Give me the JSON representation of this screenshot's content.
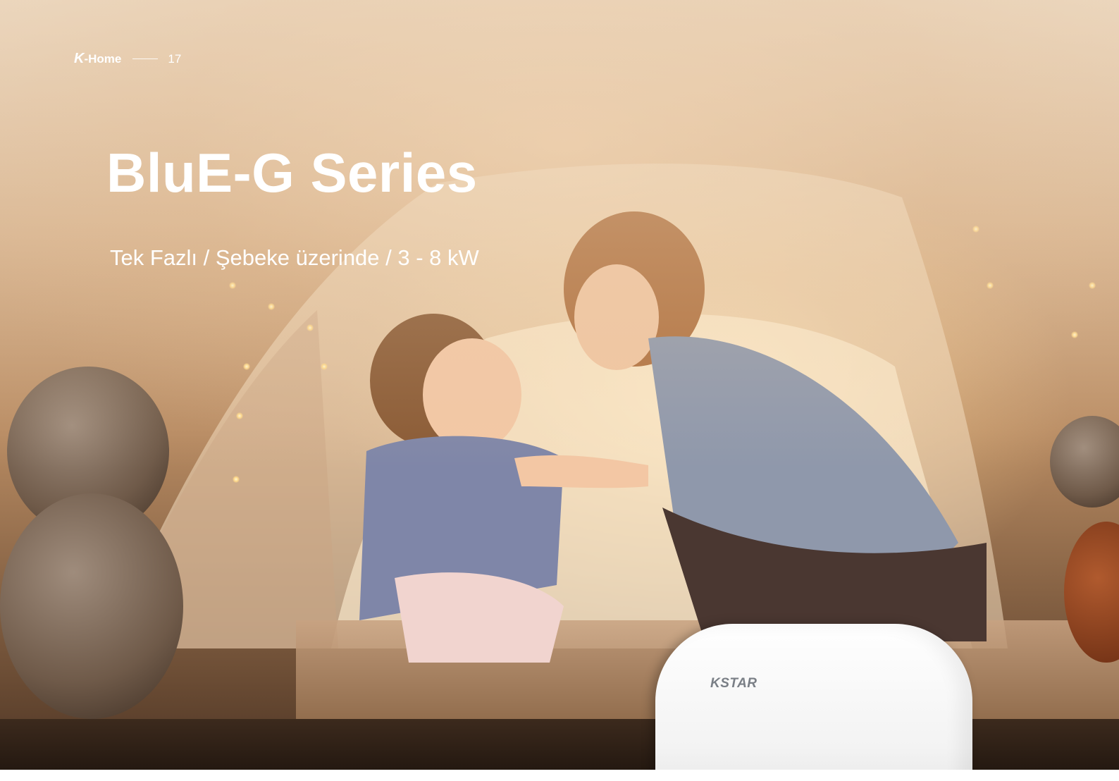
{
  "header": {
    "brand_mark": "K",
    "brand_suffix": "-Home",
    "page_number": "17"
  },
  "title": "BluE-G Series",
  "subtitle": "Tek Fazlı / Şebeke üzerinde / 3 - 8 kW",
  "product": {
    "logo": "KSTAR"
  },
  "colors": {
    "text": "#ffffff",
    "device_body": "#f4f4f4",
    "device_logo": "#7a7f86",
    "scene_warm": "#d4ae88"
  }
}
